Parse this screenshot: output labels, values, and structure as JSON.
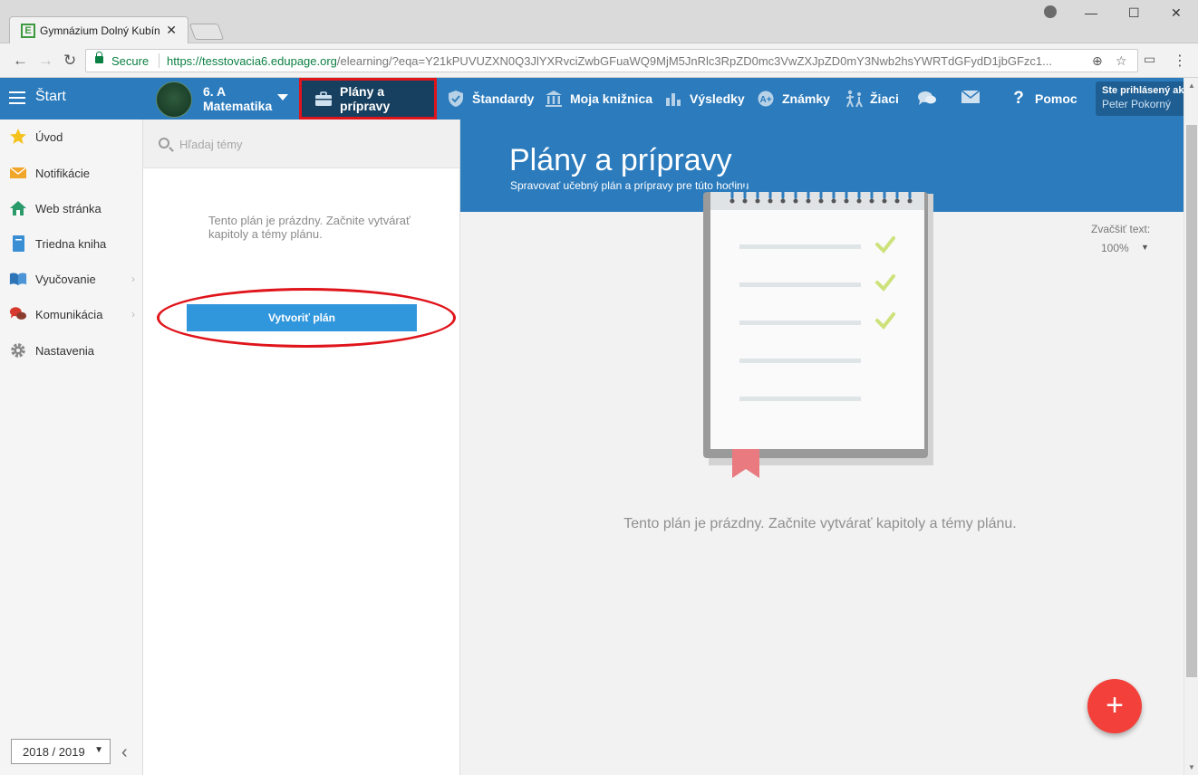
{
  "browser": {
    "tab_title": "Gymnázium Dolný Kubín",
    "secure_label": "Secure",
    "url_host": "https://tesstovacia6.edupage.org",
    "url_rest": "/elearning/?eqa=Y21kPUVUZXN0Q3JlYXRvciZwbGFuaWQ9MjM5JnRlc3RpZD0mc3VwZXJpZD0mY3Nwb2hsYWRTdGFydD1jbGFzc1..."
  },
  "appbar": {
    "start_label": "Štart",
    "class_name": "6. A",
    "class_subject": "Matematika",
    "nav": [
      {
        "label": "Plány a prípravy",
        "icon": "briefcase-icon",
        "active": true
      },
      {
        "label": "Štandardy",
        "icon": "shield-icon"
      },
      {
        "label": "Moja knižnica",
        "icon": "library-icon"
      },
      {
        "label": "Výsledky",
        "icon": "bar-chart-icon"
      },
      {
        "label": "Známky",
        "icon": "grade-icon"
      },
      {
        "label": "Žiaci",
        "icon": "students-icon"
      },
      {
        "label": "",
        "icon": "chat-icon"
      },
      {
        "label": "",
        "icon": "mail-icon"
      },
      {
        "label": "Pomoc",
        "icon": "help-icon"
      }
    ],
    "login_line1": "Ste prihlásený ako",
    "login_line2": "Peter Pokorný"
  },
  "sidebar": {
    "items": [
      {
        "label": "Úvod",
        "icon": "star-icon"
      },
      {
        "label": "Notifikácie",
        "icon": "envelope-icon"
      },
      {
        "label": "Web stránka",
        "icon": "house-icon"
      },
      {
        "label": "Triedna kniha",
        "icon": "book-icon"
      },
      {
        "label": "Vyučovanie",
        "icon": "open-book-icon"
      },
      {
        "label": "Komunikácia",
        "icon": "speech-bubbles-icon"
      },
      {
        "label": "Nastavenia",
        "icon": "gear-icon"
      }
    ],
    "year": "2018 / 2019"
  },
  "plan_panel": {
    "search_placeholder": "Hľadaj témy",
    "empty_message": "Tento plán je prázdny. Začnite vytvárať kapitoly a témy plánu.",
    "create_button": "Vytvoriť plán"
  },
  "main": {
    "title": "Plány a prípravy",
    "subtitle": "Spravovať učebný plán a prípravy pre túto hodinu",
    "zoom_label": "Zvačšiť text:",
    "zoom_value": "100%",
    "empty_message": "Tento plán je prázdny. Začnite vytvárať kapitoly a témy plánu.",
    "fab_label": "+"
  },
  "colors": {
    "brand_blue": "#2b7bbd",
    "active_nav": "#173f5f",
    "annotation_red": "#e0141b",
    "button_blue": "#3197dd",
    "fab_red": "#f3403a"
  }
}
